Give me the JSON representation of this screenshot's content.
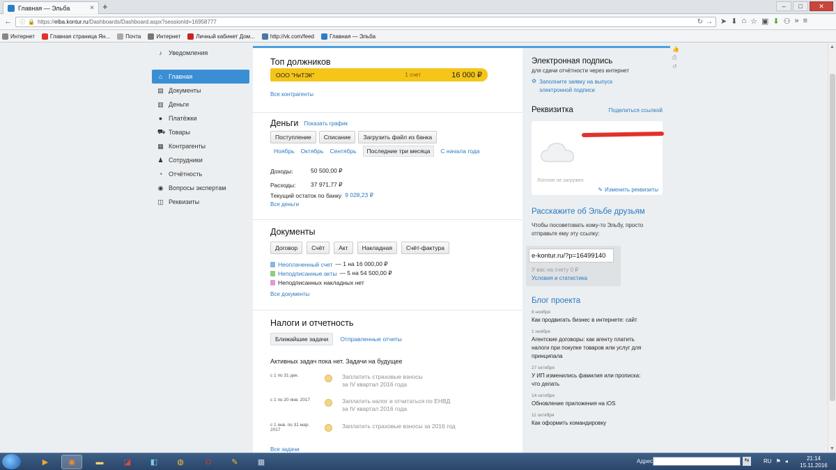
{
  "browser": {
    "tab_title": "Главная — Эльба",
    "url_prefix": "https://",
    "url_host": "elba.kontur.ru",
    "url_path": "/Dashboards/Dashboard.aspx?sessionId=16958777",
    "bookmarks": [
      {
        "label": "Интернет",
        "color": "#888888"
      },
      {
        "label": "Главная страница Ян...",
        "color": "#e0322c"
      },
      {
        "label": "Почта",
        "color": "#aaaaaa"
      },
      {
        "label": "Интернет",
        "color": "#777777"
      },
      {
        "label": "Личный кабинет Дом...",
        "color": "#cc2222"
      },
      {
        "label": "http://vk.com/feed",
        "color": "#4a76a8"
      },
      {
        "label": "Главная — Эльба",
        "color": "#2b7dc6"
      }
    ]
  },
  "sidebar": {
    "notifications": "Уведомления",
    "items": [
      {
        "label": "Главная",
        "icon": "home-icon",
        "glyph": "⌂"
      },
      {
        "label": "Документы",
        "icon": "documents-icon",
        "glyph": "▤"
      },
      {
        "label": "Деньги",
        "icon": "money-icon",
        "glyph": "▥"
      },
      {
        "label": "Платёжки",
        "icon": "payments-icon",
        "glyph": "●"
      },
      {
        "label": "Товары",
        "icon": "cart-icon",
        "glyph": "⛟"
      },
      {
        "label": "Контрагенты",
        "icon": "contractors-icon",
        "glyph": "▦"
      },
      {
        "label": "Сотрудники",
        "icon": "employee-icon",
        "glyph": "♟"
      },
      {
        "label": "Отчётность",
        "icon": "reports-icon",
        "glyph": "◔"
      },
      {
        "label": "Вопросы экспертам",
        "icon": "experts-icon",
        "glyph": "◉"
      },
      {
        "label": "Реквизиты",
        "icon": "requisites-icon",
        "glyph": "◫"
      }
    ]
  },
  "debtors": {
    "title": "Топ должников",
    "name": "ООО \"НиТЭК\"",
    "count": "1 счет",
    "amount": "16 000 ₽",
    "all_link": "Все контрагенты"
  },
  "money": {
    "title": "Деньги",
    "graph_link": "Показать график",
    "buttons": [
      "Поступление",
      "Списание",
      "Загрузить файл из банка"
    ],
    "periods": [
      "Ноябрь",
      "Октябрь",
      "Сентябрь",
      "Последние три месяца",
      "С начала года"
    ],
    "income_label": "Доходы:",
    "income_value": "50 500,00 ₽",
    "expense_label": "Расходы:",
    "expense_value": "37 971,77 ₽",
    "balance_label": "Текущий остаток по банку",
    "balance_value": "9 028,23 ₽",
    "all_link": "Все деньги"
  },
  "documents": {
    "title": "Документы",
    "buttons": [
      "Договор",
      "Счёт",
      "Акт",
      "Накладная",
      "Счёт-фактура"
    ],
    "unpaid_link": "Неоплаченный счет",
    "unpaid_rest": "— 1 на 16 000,00 ₽",
    "unsigned_link": "Неподписанные акты",
    "unsigned_rest": "— 5 на 54 500,00 ₽",
    "waybills": "Неподписанных накладных нет",
    "all_link": "Все документы"
  },
  "taxes": {
    "title": "Налоги и отчетность",
    "tab_active": "Ближайшие задачи",
    "tab_other": "Отправленные отчеты",
    "no_tasks": "Активных задач пока нет. Задачи на будущее",
    "tasks": [
      {
        "date": "с 1 по 31 дек.",
        "text1": "Заплатить страховые взносы",
        "text2": "за IV квартал 2016 года"
      },
      {
        "date": "с 1 по 20 янв. 2017",
        "text1": "Заплатить налог и отчитаться по ЕНВД",
        "text2": "за IV квартал 2016 года"
      },
      {
        "date": "с 1 янв. по 31 мар. 2017",
        "text1": "Заплатить страховые взносы за 2016 год",
        "text2": ""
      }
    ],
    "all_link": "Все задачи"
  },
  "signature": {
    "title": "Электронная подпись",
    "subtitle": "для сдачи отчётности через интернет",
    "link": "Заполните заявку на выпуск электронной подписи"
  },
  "requisites": {
    "title": "Реквизитка",
    "share_link": "Поделиться ссылкой",
    "logo_text": "Логотип не загружен",
    "edit_link": "Изменить реквизиты"
  },
  "referral": {
    "title": "Расскажите об Эльбе друзьям",
    "text": "Чтобы посоветовать кому-то Эльбу, просто отправьте ему эту ссылку:",
    "link_value": "e-kontur.ru/?p=16499140",
    "balance": "У вас на счету 0 ₽",
    "terms_link": "Условия и статистика"
  },
  "blog": {
    "title": "Блог проекта",
    "posts": [
      {
        "date": "8 ноября",
        "title": "Как продвигать бизнес в интернете: сайт"
      },
      {
        "date": "1 ноября",
        "title": "Агентские договоры: как агенту платить налоги при покупке товаров или услуг для принципала"
      },
      {
        "date": "27 октября",
        "title": "У ИП изменились фамилия или прописка: что делать"
      },
      {
        "date": "14 октября",
        "title": "Обновление приложения на iOS"
      },
      {
        "date": "11 октября",
        "title": "Как оформить командировку"
      }
    ]
  },
  "taskbar": {
    "address_label": "Адрес",
    "lang": "RU",
    "time": "21:14",
    "date": "15.11.2016"
  },
  "colors": {
    "accent": "#3a8fd4",
    "link": "#2a79c0",
    "debtor_bar": "#f5c518"
  }
}
